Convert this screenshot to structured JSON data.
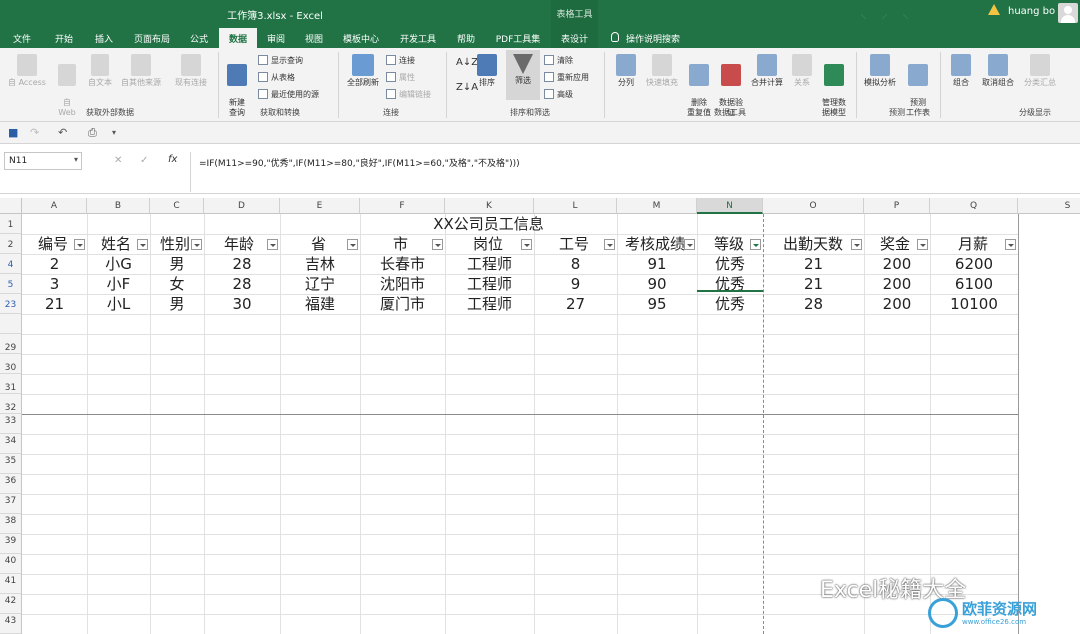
{
  "titlebar": {
    "doc_title": "工作簿3.xlsx  -  Excel",
    "context_group": "表格工具",
    "user": "huang bo"
  },
  "tabs": [
    "文件",
    "开始",
    "插入",
    "页面布局",
    "公式",
    "数据",
    "审阅",
    "视图",
    "模板中心",
    "开发工具",
    "帮助",
    "PDF工具集",
    "表设计",
    "操作说明搜索"
  ],
  "ribbon": {
    "get_external": {
      "group": "获取外部数据",
      "items": [
        "自 Access",
        "自\nWeb",
        "自文本",
        "自其他来源",
        "现有连接"
      ]
    },
    "get_transform": {
      "group": "获取和转换",
      "new_query": "新建\n查询",
      "show_query": "显示查询",
      "from_table": "从表格",
      "recent": "最近使用的源"
    },
    "connections": {
      "group": "连接",
      "refresh_all": "全部刷新",
      "connections": "连接",
      "properties": "属性",
      "edit_links": "编辑链接"
    },
    "sort_filter": {
      "group": "排序和筛选",
      "sort": "排序",
      "filter": "筛选",
      "clear": "清除",
      "reapply": "重新应用",
      "advanced": "高级"
    },
    "data_tools": {
      "group": "数据工具",
      "split": "分列",
      "flash_fill": "快速填充",
      "remove_dup": "删除\n重复值",
      "validation": "数据验\n证",
      "consolidate": "合并计算",
      "relations": "关系",
      "manage_model": "管理数\n据模型"
    },
    "forecast": {
      "group": "预测",
      "what_if": "模拟分析",
      "forecast_sheet": "预测\n工作表"
    },
    "outline": {
      "group": "分级显示",
      "group_btn": "组合",
      "ungroup": "取消组合",
      "subtotal": "分类汇总"
    }
  },
  "formula_bar": {
    "name_box": "N11",
    "fx": "fx",
    "formula": "=IF(M11>=90,\"优秀\",IF(M11>=80,\"良好\",IF(M11>=60,\"及格\",\"不及格\")))"
  },
  "columns": [
    "A",
    "B",
    "C",
    "D",
    "E",
    "F",
    "K",
    "L",
    "M",
    "N",
    "O",
    "P",
    "Q",
    "S"
  ],
  "rows": [
    "1",
    "2",
    "4",
    "5",
    "23",
    "29",
    "30",
    "31",
    "32",
    "33",
    "34",
    "35",
    "36",
    "37",
    "38",
    "39",
    "40",
    "41",
    "42",
    "43"
  ],
  "sheet": {
    "title": "XX公司员工信息",
    "headers": [
      "编号",
      "姓名",
      "性别",
      "年龄",
      "省",
      "市",
      "岗位",
      "工号",
      "考核成绩",
      "等级",
      "出勤天数",
      "奖金",
      "月薪"
    ],
    "data": [
      [
        "2",
        "小G",
        "男",
        "28",
        "吉林",
        "长春市",
        "工程师",
        "8",
        "91",
        "优秀",
        "21",
        "200",
        "6200"
      ],
      [
        "3",
        "小F",
        "女",
        "28",
        "辽宁",
        "沈阳市",
        "工程师",
        "9",
        "90",
        "优秀",
        "21",
        "200",
        "6100"
      ],
      [
        "21",
        "小L",
        "男",
        "30",
        "福建",
        "厦门市",
        "工程师",
        "27",
        "95",
        "优秀",
        "28",
        "200",
        "10100"
      ]
    ]
  },
  "watermark": {
    "text": "Excel秘籍大全",
    "site": "欧菲资源网",
    "url": "www.office26.com"
  }
}
